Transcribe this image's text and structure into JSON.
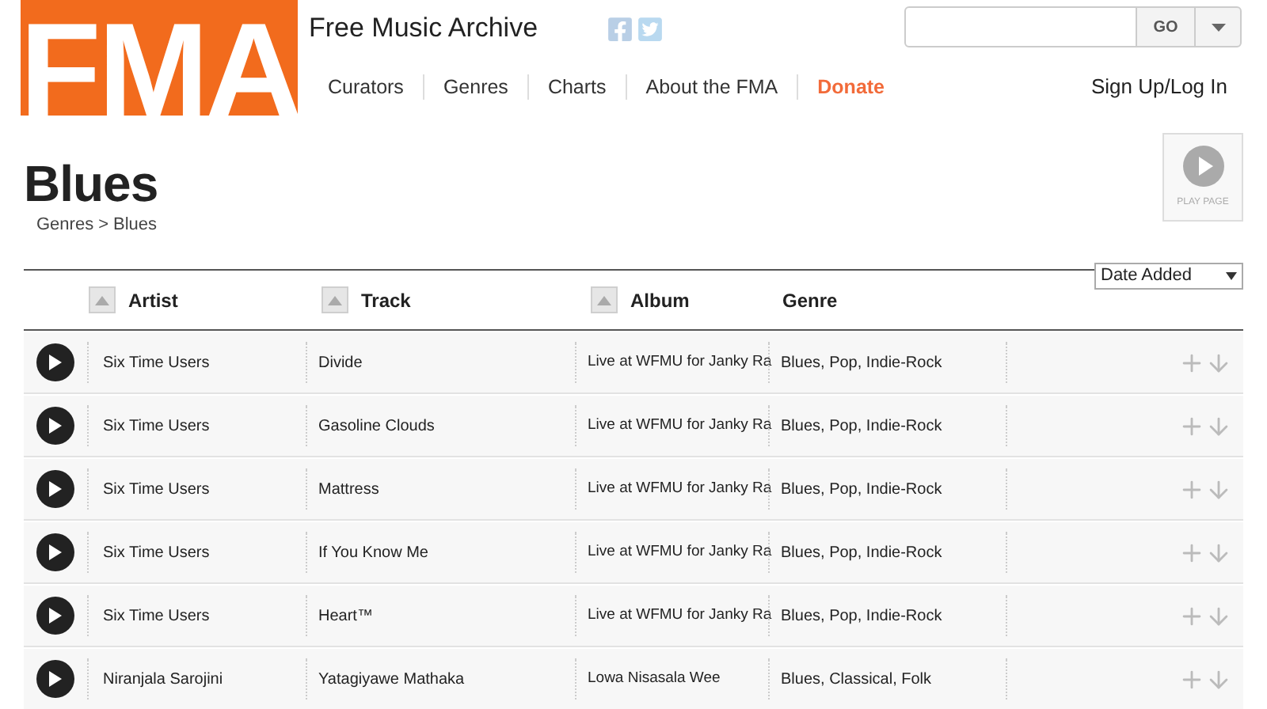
{
  "logo": "FMA",
  "site_title": "Free Music Archive",
  "search": {
    "button": "GO"
  },
  "nav": [
    {
      "label": "Curators",
      "highlighted": false
    },
    {
      "label": "Genres",
      "highlighted": false
    },
    {
      "label": "Charts",
      "highlighted": false
    },
    {
      "label": "About the FMA",
      "highlighted": false
    },
    {
      "label": "Donate",
      "highlighted": true
    }
  ],
  "account_link": "Sign Up/Log In",
  "page_title": "Blues",
  "breadcrumb": {
    "items": [
      "Genres",
      "Blues"
    ],
    "separator": ">"
  },
  "play_page": "PLAY PAGE",
  "sort_select": "Date Added",
  "columns": [
    {
      "label": "Artist",
      "sortable": true
    },
    {
      "label": "Track",
      "sortable": true
    },
    {
      "label": "Album",
      "sortable": true
    },
    {
      "label": "Genre",
      "sortable": false
    }
  ],
  "rows": [
    {
      "artist": "Six Time Users",
      "track": "Divide",
      "album": "Live at WFMU for Janky Ra",
      "genre": "Blues, Pop, Indie-Rock"
    },
    {
      "artist": "Six Time Users",
      "track": "Gasoline Clouds",
      "album": "Live at WFMU for Janky Ra",
      "genre": "Blues, Pop, Indie-Rock"
    },
    {
      "artist": "Six Time Users",
      "track": "Mattress",
      "album": "Live at WFMU for Janky Ra",
      "genre": "Blues, Pop, Indie-Rock"
    },
    {
      "artist": "Six Time Users",
      "track": "If You Know Me",
      "album": "Live at WFMU for Janky Ra",
      "genre": "Blues, Pop, Indie-Rock"
    },
    {
      "artist": "Six Time Users",
      "track": "Heart™",
      "album": "Live at WFMU for Janky Ra",
      "genre": "Blues, Pop, Indie-Rock"
    },
    {
      "artist": "Niranjala Sarojini",
      "track": "Yatagiyawe Mathaka",
      "album": "Lowa Nisasala Wee",
      "genre": "Blues, Classical, Folk"
    }
  ]
}
